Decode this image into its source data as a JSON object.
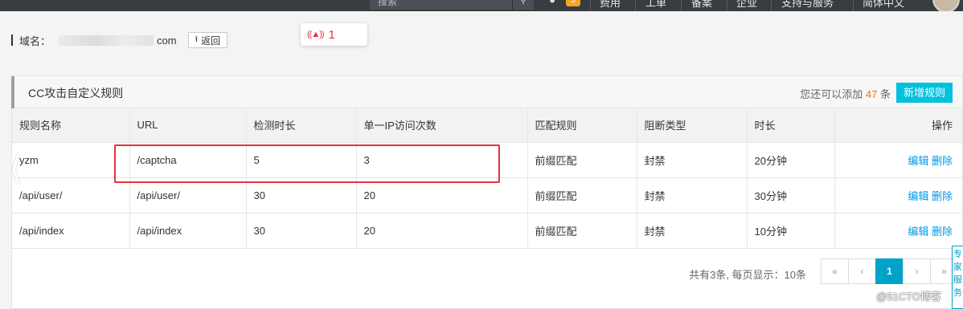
{
  "topbar": {
    "search_placeholder": "搜索",
    "search_icon": "search-icon",
    "bell_icon": "bell-icon",
    "notification_count": "3",
    "nav": [
      "费用",
      "工单",
      "备案",
      "企业",
      "支持与服务",
      "简体中文"
    ]
  },
  "domain": {
    "label": "域名：",
    "suffix": "com",
    "back_label": "返回"
  },
  "alert": {
    "count": "1"
  },
  "panel": {
    "title": "CC攻击自定义规则",
    "quota_prefix": "您还可以添加",
    "quota_value": "47",
    "quota_suffix": "条",
    "add_button": "新增规则"
  },
  "table": {
    "columns": [
      "规则名称",
      "URL",
      "检测时长",
      "单一IP访问次数",
      "匹配规则",
      "阻断类型",
      "时长",
      "操作"
    ],
    "rows": [
      {
        "name": "yzm",
        "url": "/captcha",
        "duration": "5",
        "count": "3",
        "match": "前缀匹配",
        "block": "封禁",
        "time": "20分钟"
      },
      {
        "name": "/api/user/",
        "url": "/api/user/",
        "duration": "30",
        "count": "20",
        "match": "前缀匹配",
        "block": "封禁",
        "time": "30分钟"
      },
      {
        "name": "/api/index",
        "url": "/api/index",
        "duration": "30",
        "count": "20",
        "match": "前缀匹配",
        "block": "封禁",
        "time": "10分钟"
      }
    ],
    "edit_label": "编辑",
    "delete_label": "删除"
  },
  "pagination": {
    "info": "共有3条, 每页显示：10条",
    "first": "«",
    "prev": "‹",
    "current": "1",
    "next": "›",
    "last": "»"
  },
  "float_tab": "专家服务",
  "watermark": "@51CTO博客"
}
